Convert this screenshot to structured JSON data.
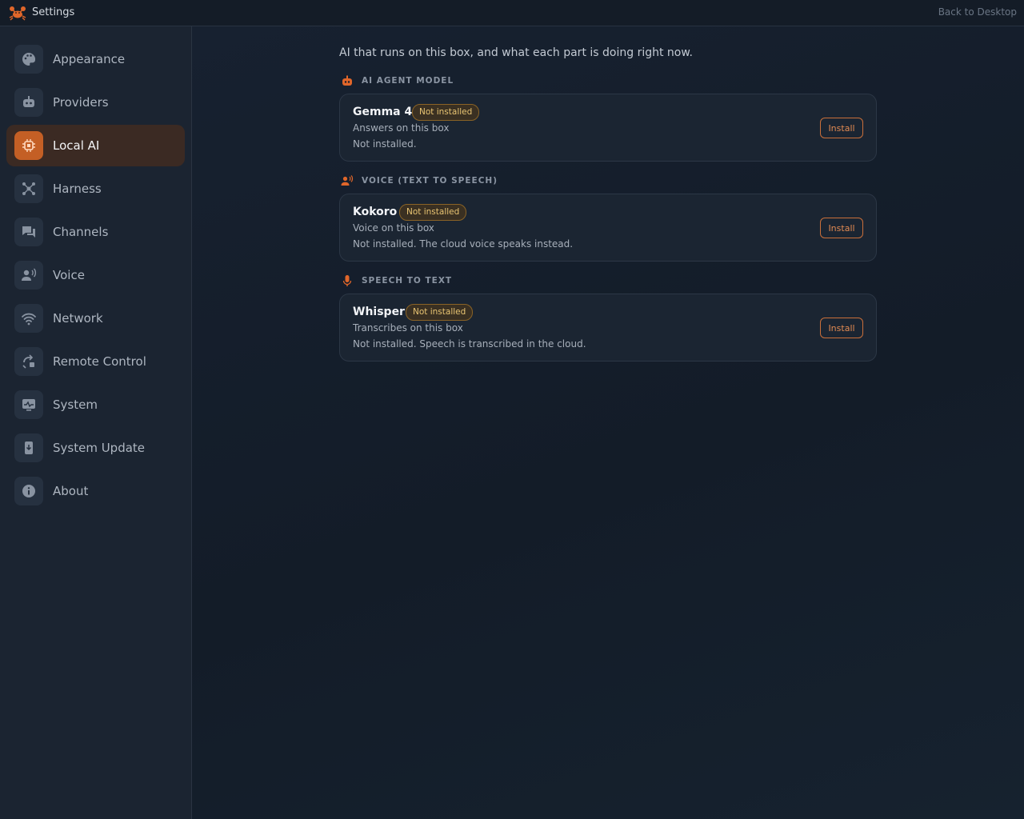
{
  "window": {
    "title": "Settings",
    "back_label": "Back to Desktop"
  },
  "colors": {
    "accent": "#c45f25",
    "badge_text": "#e8c472",
    "sidebar_bg": "#1b2431",
    "content_bg": "#131c28"
  },
  "sidebar": {
    "items": [
      {
        "label": "Appearance",
        "icon": "palette-icon"
      },
      {
        "label": "Providers",
        "icon": "robot-icon"
      },
      {
        "label": "Local AI",
        "icon": "chip-icon",
        "active": true
      },
      {
        "label": "Harness",
        "icon": "hub-icon"
      },
      {
        "label": "Channels",
        "icon": "chat-icon"
      },
      {
        "label": "Voice",
        "icon": "voice-icon"
      },
      {
        "label": "Network",
        "icon": "wifi-icon"
      },
      {
        "label": "Remote Control",
        "icon": "remote-icon"
      },
      {
        "label": "System",
        "icon": "monitor-icon"
      },
      {
        "label": "System Update",
        "icon": "update-icon"
      },
      {
        "label": "About",
        "icon": "info-icon"
      }
    ]
  },
  "main": {
    "intro": "AI that runs on this box, and what each part is doing right now.",
    "sections": [
      {
        "title": "AI AGENT MODEL",
        "icon": "robot-icon",
        "card": {
          "name": "Gemma 4",
          "badge": "Not installed",
          "subtitle": "Answers on this box",
          "status": "Not installed.",
          "button": "Install"
        }
      },
      {
        "title": "VOICE (TEXT TO SPEECH)",
        "icon": "voice-icon",
        "card": {
          "name": "Kokoro",
          "badge": "Not installed",
          "subtitle": "Voice on this box",
          "status": "Not installed. The cloud voice speaks instead.",
          "button": "Install"
        }
      },
      {
        "title": "SPEECH TO TEXT",
        "icon": "microphone-icon",
        "card": {
          "name": "Whisper",
          "badge": "Not installed",
          "subtitle": "Transcribes on this box",
          "status": "Not installed. Speech is transcribed in the cloud.",
          "button": "Install"
        }
      }
    ]
  }
}
